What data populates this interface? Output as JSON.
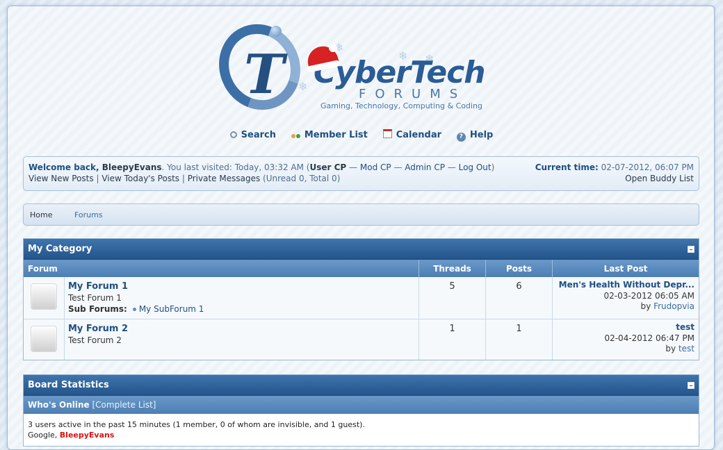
{
  "logo": {
    "brand": "CyberTech",
    "forums": "FORUMS",
    "tagline": "Gaming, Technology, Computing & Coding"
  },
  "toplinks": [
    {
      "label": "Search",
      "icon": "search-icon"
    },
    {
      "label": "Member List",
      "icon": "members-icon"
    },
    {
      "label": "Calendar",
      "icon": "calendar-icon"
    },
    {
      "label": "Help",
      "icon": "help-icon"
    }
  ],
  "welcome": {
    "prefix": "Welcome back, ",
    "username": "BleepyEvans",
    "visited": ". You last visited: Today, 03:32 AM (",
    "user_cp": "User CP",
    "mod_cp": "Mod CP",
    "admin_cp": "Admin CP",
    "logout": "Log Out",
    "close_paren": ")",
    "sep": " — ",
    "view_new": "View New Posts",
    "view_today": "View Today's Posts",
    "private_messages": "Private Messages",
    "pm_counts": "(Unread 0, Total 0)",
    "current_time_label": "Current time:",
    "current_time": "02-07-2012, 06:07 PM",
    "buddy_list": "Open Buddy List"
  },
  "breadcrumb": [
    {
      "label": "Home"
    },
    {
      "label": "Forums"
    }
  ],
  "category": {
    "title": "My Category",
    "columns": {
      "forum": "Forum",
      "threads": "Threads",
      "posts": "Posts",
      "last_post": "Last Post"
    },
    "forums": [
      {
        "name": "My Forum 1",
        "description": "Test Forum 1",
        "sub_label": "Sub Forums:",
        "sub_forum": "My SubForum 1",
        "threads": "5",
        "posts": "6",
        "last_title": "Men's Health Without Depr...",
        "last_date": "02-03-2012 06:05 AM",
        "last_by_prefix": "by ",
        "last_by": "Frudopvia"
      },
      {
        "name": "My Forum 2",
        "description": "Test Forum 2",
        "threads": "1",
        "posts": "1",
        "last_title": "test",
        "last_date": "02-04-2012 06:47 PM",
        "last_by_prefix": "by ",
        "last_by": "test"
      }
    ]
  },
  "stats": {
    "title": "Board Statistics",
    "whos_online": "Who's Online",
    "complete_list": "[Complete List]",
    "active_line": "3 users active in the past 15 minutes (1 member, 0 of whom are invisible, and 1 guest).",
    "online_guest": "Google, ",
    "online_member": "BleepyEvans"
  }
}
